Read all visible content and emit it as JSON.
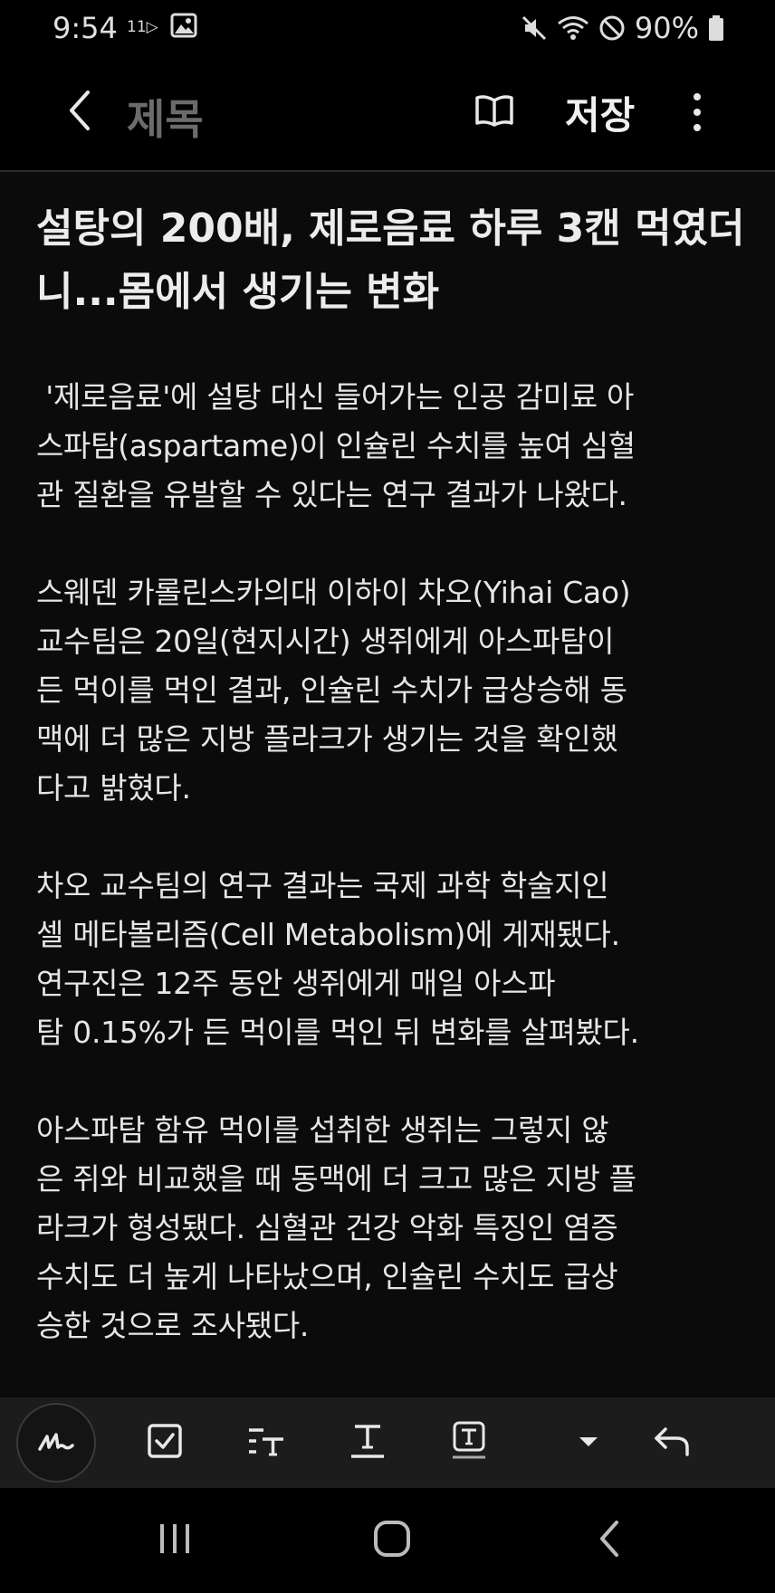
{
  "status_bar": {
    "time": "9:54",
    "indicator": "11▷",
    "battery": "90%"
  },
  "app_bar": {
    "title_placeholder": "제목",
    "save_label": "저장"
  },
  "note": {
    "headline_lines": [
      "설탕의 200배, 제로음료 하루 3캔",
      "먹였더니...몸에서 생기는 변화"
    ],
    "paragraphs": [
      [
        " '제로음료'에 설탕 대신 들어가는 인공 감미료 아",
        "스파탐(aspartame)이 인슐린 수치를 높여 심혈",
        "관 질환을 유발할 수 있다는 연구 결과가 나왔다."
      ],
      [
        "스웨덴 카롤린스카의대 이하이 차오(Yihai Cao)",
        "교수팀은 20일(현지시간) 생쥐에게 아스파탐이",
        "든 먹이를 먹인 결과, 인슐린 수치가 급상승해 동",
        "맥에 더 많은 지방 플라크가 생기는 것을 확인했",
        "다고 밝혔다."
      ],
      [
        "차오 교수팀의 연구 결과는 국제 과학 학술지인",
        "셀 메타볼리즘(Cell Metabolism)에 게재됐다.",
        "연구진은 12주 동안 생쥐에게 매일 아스파",
        "탐 0.15%가 든 먹이를 먹인 뒤 변화를 살펴봤다."
      ],
      [
        "아스파탐 함유 먹이를 섭취한 생쥐는 그렇지 않",
        "은 쥐와 비교했을 때 동맥에 더 크고 많은 지방 플",
        "라크가 형성됐다. 심혈관 건강 악화 특징인 염증",
        "수치도 더 높게 나타났으며, 인슐린 수치도 급상",
        "승한 것으로 조사됐다."
      ]
    ]
  },
  "toolbar": {
    "items": [
      "pen-icon",
      "checkbox-icon",
      "text-style-icon",
      "text-underline-icon",
      "text-box-icon",
      "dropdown-icon",
      "undo-icon"
    ]
  },
  "nav_bar": {
    "items": [
      "recents-icon",
      "home-icon",
      "back-icon"
    ]
  },
  "colors": {
    "background": "#000000",
    "note_background": "#0b0b0b",
    "toolbar_background": "#1c1c1c",
    "title_placeholder": "#6b6b6b",
    "text": "#e6e6e6"
  }
}
